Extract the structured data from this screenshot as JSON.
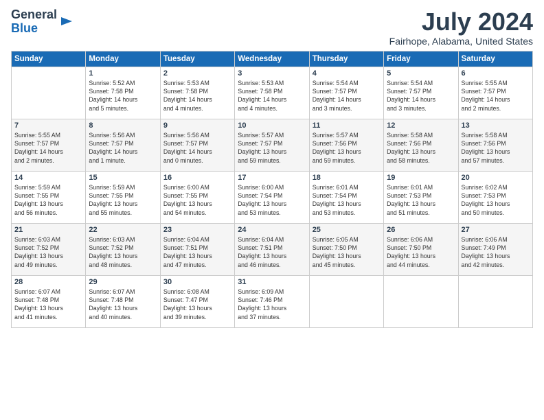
{
  "header": {
    "logo_line1": "General",
    "logo_line2": "Blue",
    "month_year": "July 2024",
    "location": "Fairhope, Alabama, United States"
  },
  "weekdays": [
    "Sunday",
    "Monday",
    "Tuesday",
    "Wednesday",
    "Thursday",
    "Friday",
    "Saturday"
  ],
  "weeks": [
    [
      {
        "day": "",
        "text": ""
      },
      {
        "day": "1",
        "text": "Sunrise: 5:52 AM\nSunset: 7:58 PM\nDaylight: 14 hours\nand 5 minutes."
      },
      {
        "day": "2",
        "text": "Sunrise: 5:53 AM\nSunset: 7:58 PM\nDaylight: 14 hours\nand 4 minutes."
      },
      {
        "day": "3",
        "text": "Sunrise: 5:53 AM\nSunset: 7:58 PM\nDaylight: 14 hours\nand 4 minutes."
      },
      {
        "day": "4",
        "text": "Sunrise: 5:54 AM\nSunset: 7:57 PM\nDaylight: 14 hours\nand 3 minutes."
      },
      {
        "day": "5",
        "text": "Sunrise: 5:54 AM\nSunset: 7:57 PM\nDaylight: 14 hours\nand 3 minutes."
      },
      {
        "day": "6",
        "text": "Sunrise: 5:55 AM\nSunset: 7:57 PM\nDaylight: 14 hours\nand 2 minutes."
      }
    ],
    [
      {
        "day": "7",
        "text": "Sunrise: 5:55 AM\nSunset: 7:57 PM\nDaylight: 14 hours\nand 2 minutes."
      },
      {
        "day": "8",
        "text": "Sunrise: 5:56 AM\nSunset: 7:57 PM\nDaylight: 14 hours\nand 1 minute."
      },
      {
        "day": "9",
        "text": "Sunrise: 5:56 AM\nSunset: 7:57 PM\nDaylight: 14 hours\nand 0 minutes."
      },
      {
        "day": "10",
        "text": "Sunrise: 5:57 AM\nSunset: 7:57 PM\nDaylight: 13 hours\nand 59 minutes."
      },
      {
        "day": "11",
        "text": "Sunrise: 5:57 AM\nSunset: 7:56 PM\nDaylight: 13 hours\nand 59 minutes."
      },
      {
        "day": "12",
        "text": "Sunrise: 5:58 AM\nSunset: 7:56 PM\nDaylight: 13 hours\nand 58 minutes."
      },
      {
        "day": "13",
        "text": "Sunrise: 5:58 AM\nSunset: 7:56 PM\nDaylight: 13 hours\nand 57 minutes."
      }
    ],
    [
      {
        "day": "14",
        "text": "Sunrise: 5:59 AM\nSunset: 7:55 PM\nDaylight: 13 hours\nand 56 minutes."
      },
      {
        "day": "15",
        "text": "Sunrise: 5:59 AM\nSunset: 7:55 PM\nDaylight: 13 hours\nand 55 minutes."
      },
      {
        "day": "16",
        "text": "Sunrise: 6:00 AM\nSunset: 7:55 PM\nDaylight: 13 hours\nand 54 minutes."
      },
      {
        "day": "17",
        "text": "Sunrise: 6:00 AM\nSunset: 7:54 PM\nDaylight: 13 hours\nand 53 minutes."
      },
      {
        "day": "18",
        "text": "Sunrise: 6:01 AM\nSunset: 7:54 PM\nDaylight: 13 hours\nand 53 minutes."
      },
      {
        "day": "19",
        "text": "Sunrise: 6:01 AM\nSunset: 7:53 PM\nDaylight: 13 hours\nand 51 minutes."
      },
      {
        "day": "20",
        "text": "Sunrise: 6:02 AM\nSunset: 7:53 PM\nDaylight: 13 hours\nand 50 minutes."
      }
    ],
    [
      {
        "day": "21",
        "text": "Sunrise: 6:03 AM\nSunset: 7:52 PM\nDaylight: 13 hours\nand 49 minutes."
      },
      {
        "day": "22",
        "text": "Sunrise: 6:03 AM\nSunset: 7:52 PM\nDaylight: 13 hours\nand 48 minutes."
      },
      {
        "day": "23",
        "text": "Sunrise: 6:04 AM\nSunset: 7:51 PM\nDaylight: 13 hours\nand 47 minutes."
      },
      {
        "day": "24",
        "text": "Sunrise: 6:04 AM\nSunset: 7:51 PM\nDaylight: 13 hours\nand 46 minutes."
      },
      {
        "day": "25",
        "text": "Sunrise: 6:05 AM\nSunset: 7:50 PM\nDaylight: 13 hours\nand 45 minutes."
      },
      {
        "day": "26",
        "text": "Sunrise: 6:06 AM\nSunset: 7:50 PM\nDaylight: 13 hours\nand 44 minutes."
      },
      {
        "day": "27",
        "text": "Sunrise: 6:06 AM\nSunset: 7:49 PM\nDaylight: 13 hours\nand 42 minutes."
      }
    ],
    [
      {
        "day": "28",
        "text": "Sunrise: 6:07 AM\nSunset: 7:48 PM\nDaylight: 13 hours\nand 41 minutes."
      },
      {
        "day": "29",
        "text": "Sunrise: 6:07 AM\nSunset: 7:48 PM\nDaylight: 13 hours\nand 40 minutes."
      },
      {
        "day": "30",
        "text": "Sunrise: 6:08 AM\nSunset: 7:47 PM\nDaylight: 13 hours\nand 39 minutes."
      },
      {
        "day": "31",
        "text": "Sunrise: 6:09 AM\nSunset: 7:46 PM\nDaylight: 13 hours\nand 37 minutes."
      },
      {
        "day": "",
        "text": ""
      },
      {
        "day": "",
        "text": ""
      },
      {
        "day": "",
        "text": ""
      }
    ]
  ]
}
